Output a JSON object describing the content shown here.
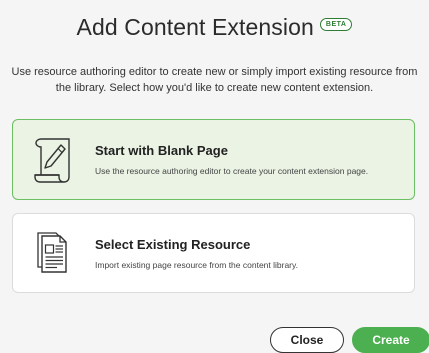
{
  "dialog": {
    "title": "Add Content Extension",
    "badge": "BETA",
    "description": "Use resource authoring editor to create new or simply import existing resource from the library. Select how you'd like to create new content extension."
  },
  "options": [
    {
      "title": "Start with Blank Page",
      "subtitle": "Use the resource authoring editor to create your content extension page.",
      "icon": "scroll-pencil-icon",
      "selected": true
    },
    {
      "title": "Select Existing Resource",
      "subtitle": "Import existing page resource from the content library.",
      "icon": "document-icon",
      "selected": false
    }
  ],
  "buttons": {
    "close_label": "Close",
    "create_label": "Create"
  },
  "colors": {
    "accent": "#4caf50",
    "selected_bg": "#eaf3e4",
    "selected_border": "#6cbf63"
  }
}
